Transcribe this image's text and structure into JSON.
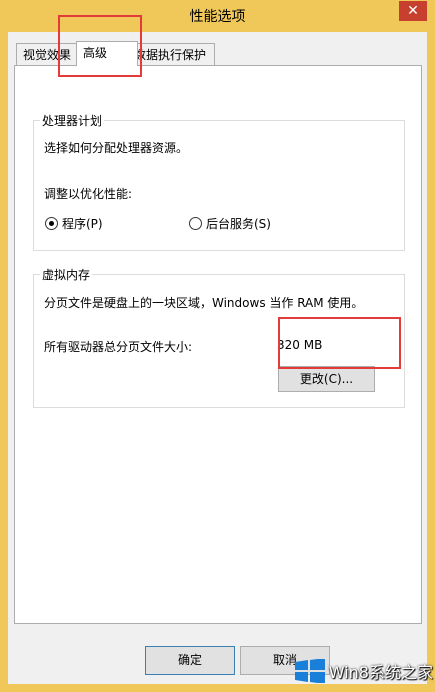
{
  "window": {
    "title": "性能选项",
    "close_label": "✕"
  },
  "tabs": [
    {
      "label": "视觉效果"
    },
    {
      "label": "高级"
    },
    {
      "label": "数据执行保护"
    }
  ],
  "processor": {
    "group_title": "处理器计划",
    "description": "选择如何分配处理器资源。",
    "optimize_label": "调整以优化性能:",
    "options": [
      {
        "label": "程序(P)",
        "checked": true
      },
      {
        "label": "后台服务(S)",
        "checked": false
      }
    ]
  },
  "virtual_memory": {
    "group_title": "虚拟内存",
    "description": "分页文件是硬盘上的一块区域，Windows 当作 RAM 使用。",
    "total_label": "所有驱动器总分页文件大小:",
    "total_value": "320 MB",
    "change_button": "更改(C)..."
  },
  "footer": {
    "ok_button": "确定",
    "cancel_button": "取消"
  },
  "watermark": {
    "text": "Win8系统之家"
  }
}
